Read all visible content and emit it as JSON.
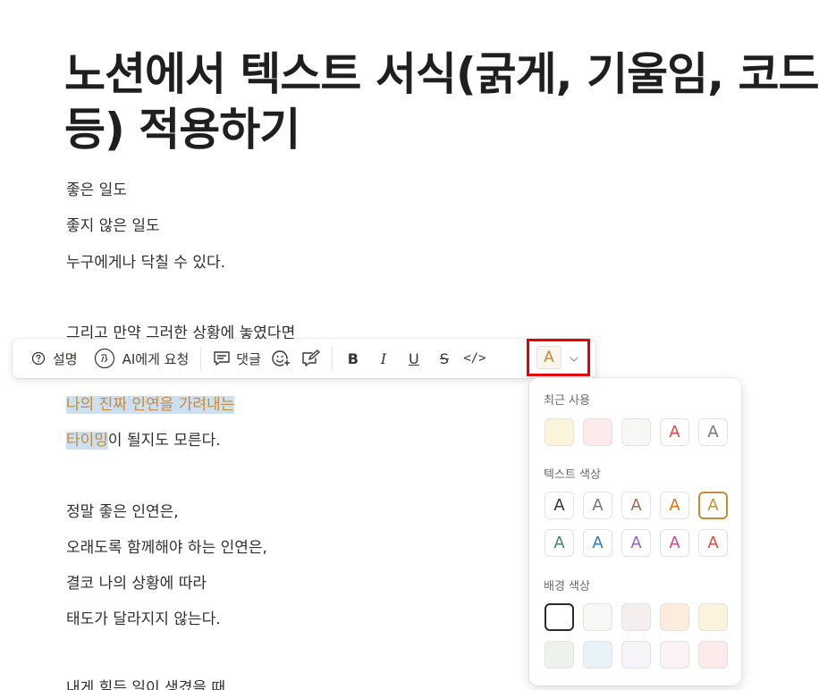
{
  "title": {
    "line1": "노션에서 텍스트 서식(굵게, 기울임, 코드",
    "line2": "등) 적용하기"
  },
  "body": {
    "l1": "좋은 일도",
    "l2": "좋지 않은 일도",
    "l3": "누구에게나 닥칠 수 있다.",
    "l4": "그리고 만약 그러한 상황에 놓였다면",
    "l5": "나의 진짜 인연을 가려내는 ",
    "l6a": "타이밍",
    "l6b": "이 될지도 모른다.",
    "l7": "정말 좋은 인연은,",
    "l8": "오래도록 함께해야 하는 인연은,",
    "l9": "결코 나의 상황에 따라",
    "l10": "태도가 달라지지 않는다.",
    "l11": "내게 힘든 일이 생겼을 때"
  },
  "toolbar": {
    "explain_label": "설명",
    "ai_label": "AI에게 요청",
    "comment_label": "댓글",
    "bold": "B",
    "italic": "I",
    "underline": "U",
    "strike": "S",
    "code": "</>",
    "color_letter": "A"
  },
  "color_menu": {
    "recent_title": "최근 사용",
    "text_title": "텍스트 색상",
    "bg_title": "배경 색상",
    "letter": "A",
    "recent": [
      {
        "kind": "bg",
        "bg": "#fbf3db"
      },
      {
        "kind": "bg",
        "bg": "#fdebec"
      },
      {
        "kind": "bg",
        "bg": "#f7f7f5"
      },
      {
        "kind": "text",
        "color": "#d44c47"
      },
      {
        "kind": "text",
        "color": "#787774"
      }
    ],
    "text_row1": [
      "#37352f",
      "#787774",
      "#9f6b53",
      "#d9730d",
      "#cb912f"
    ],
    "text_row2": [
      "#448361",
      "#337ea9",
      "#9065b0",
      "#c14c8a",
      "#d44c47"
    ],
    "bg_row1": [
      "#ffffff",
      "#f7f7f5",
      "#f4eeee",
      "#fbecdd",
      "#fbf3db"
    ],
    "bg_row2": [
      "#edf3ec",
      "#e7f3f8",
      "#f6f3f9",
      "#fbf2f5",
      "#fdebec"
    ]
  },
  "colors": {
    "highlight_bg": "#cce0f2",
    "highlight_text": "#c88a3a",
    "focus_outline": "#e60000"
  }
}
